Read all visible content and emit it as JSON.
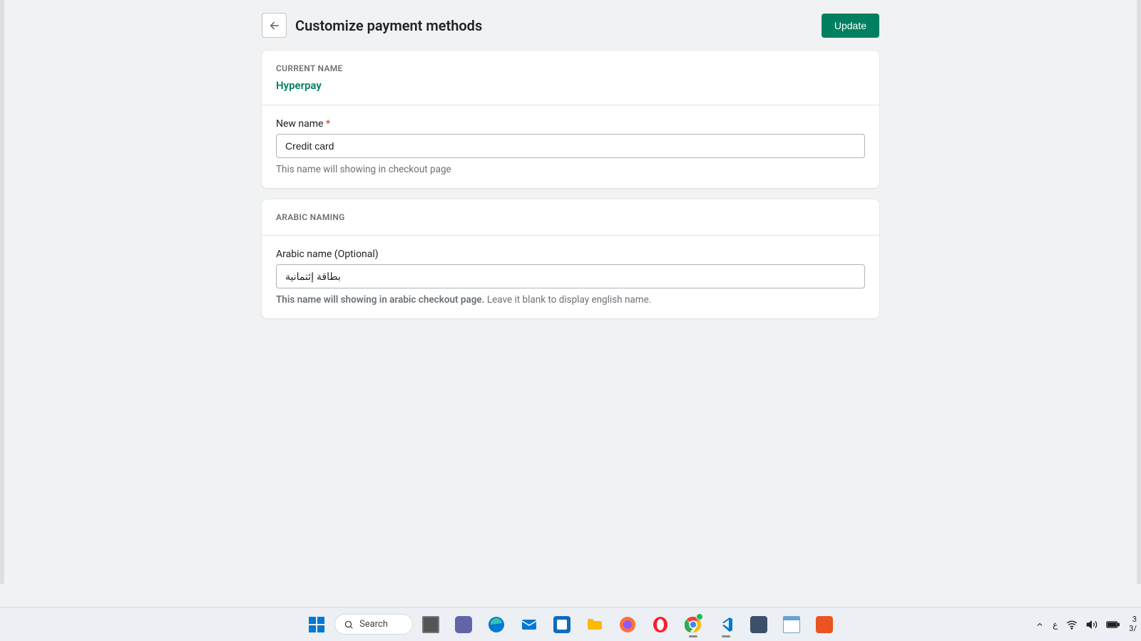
{
  "header": {
    "title": "Customize payment methods",
    "update_label": "Update"
  },
  "current_name": {
    "section_label": "CURRENT NAME",
    "value": "Hyperpay"
  },
  "new_name": {
    "label": "New name",
    "required_mark": "*",
    "value": "Credit card",
    "help": "This name will showing in checkout page"
  },
  "arabic": {
    "section_label": "ARABIC NAMING",
    "label": "Arabic name (Optional)",
    "value": "بطاقة إئتمانية",
    "help_bold": "This name will showing in arabic checkout page.",
    "help_rest": " Leave it blank to display english name."
  },
  "taskbar": {
    "search_placeholder": "Search",
    "lang": "ع",
    "date_top": "3",
    "date_bottom": "3/"
  }
}
